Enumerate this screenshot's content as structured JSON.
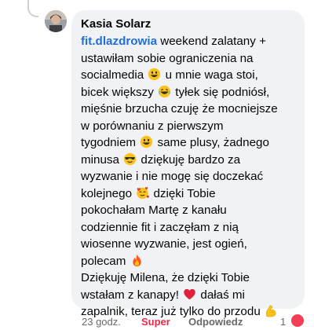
{
  "comment": {
    "author": "Kasia Solarz",
    "mention": "fit.dlazdrowia",
    "lines": [
      [
        {
          "t": " weekend zalatany +"
        }
      ],
      [
        {
          "t": "ustawiłam sobie ograniczenia na"
        }
      ],
      [
        {
          "t": "socialmedia "
        },
        {
          "e": "smile"
        },
        {
          "t": " u mnie waga stoi,"
        }
      ],
      [
        {
          "t": "bicek większy "
        },
        {
          "e": "laugh"
        },
        {
          "t": " tyłek się podniósł,"
        }
      ],
      [
        {
          "t": "mięśnie brzucha czuję że mocniejsze"
        }
      ],
      [
        {
          "t": "w porównaniu z pierwszym"
        }
      ],
      [
        {
          "t": "tygodniem "
        },
        {
          "e": "smile"
        },
        {
          "t": " same plusy, żadnego"
        }
      ],
      [
        {
          "t": "minusa "
        },
        {
          "e": "sunglasses"
        },
        {
          "t": " dziękuję bardzo za"
        }
      ],
      [
        {
          "t": "wyzwanie i nie mogę się doczekać"
        }
      ],
      [
        {
          "t": "kolejnego "
        },
        {
          "e": "hearts"
        },
        {
          "t": " dzięki Tobie"
        }
      ],
      [
        {
          "t": "pokochałam Martę z kanału"
        }
      ],
      [
        {
          "t": "codziennie fit i zaczęłam z nią"
        }
      ],
      [
        {
          "t": "wiosenne wyzwanie, jest ogień,"
        }
      ],
      [
        {
          "t": "polecam "
        },
        {
          "e": "fire"
        }
      ],
      [
        {
          "t": "Dziękuję Milena, że dzięki Tobie"
        }
      ],
      [
        {
          "t": "wstałam z kanapy! "
        },
        {
          "e": "heart"
        },
        {
          "t": " dałaś mi"
        }
      ],
      [
        {
          "t": "zapalnik, teraz już tylko do przodu "
        },
        {
          "e": "muscle"
        }
      ]
    ]
  },
  "actions": {
    "time": "23 godz.",
    "reaction_label": "Super",
    "reply": "Odpowiedz",
    "reaction_count": "1"
  },
  "colors": {
    "mention": "#1e6fd9",
    "reaction": "#f02849",
    "bubble": "#f0f2f5"
  }
}
